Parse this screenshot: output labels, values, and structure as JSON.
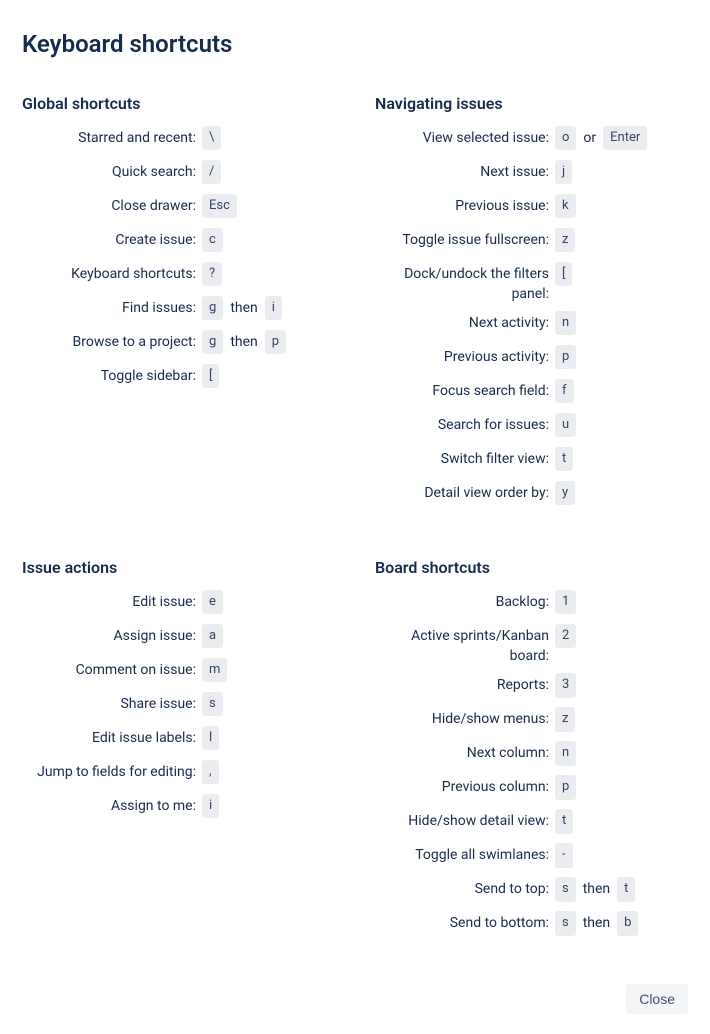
{
  "title": "Keyboard shortcuts",
  "close_label": "Close",
  "joiners": {
    "then": "then",
    "or": "or"
  },
  "sections": [
    {
      "id": "global",
      "heading": "Global shortcuts",
      "rows": [
        {
          "label": "Starred and recent:",
          "keys": [
            {
              "k": "\\"
            }
          ]
        },
        {
          "label": "Quick search:",
          "keys": [
            {
              "k": "/"
            }
          ]
        },
        {
          "label": "Close drawer:",
          "keys": [
            {
              "k": "Esc"
            }
          ]
        },
        {
          "label": "Create issue:",
          "keys": [
            {
              "k": "c"
            }
          ]
        },
        {
          "label": "Keyboard shortcuts:",
          "keys": [
            {
              "k": "?"
            }
          ]
        },
        {
          "label": "Find issues:",
          "keys": [
            {
              "k": "g"
            },
            {
              "j": "then"
            },
            {
              "k": "i"
            }
          ]
        },
        {
          "label": "Browse to a project:",
          "keys": [
            {
              "k": "g"
            },
            {
              "j": "then"
            },
            {
              "k": "p"
            }
          ]
        },
        {
          "label": "Toggle sidebar:",
          "keys": [
            {
              "k": "["
            }
          ]
        }
      ]
    },
    {
      "id": "navigating",
      "heading": "Navigating issues",
      "rows": [
        {
          "label": "View selected issue:",
          "keys": [
            {
              "k": "o"
            },
            {
              "j": "or"
            },
            {
              "k": "Enter"
            }
          ]
        },
        {
          "label": "Next issue:",
          "keys": [
            {
              "k": "j"
            }
          ]
        },
        {
          "label": "Previous issue:",
          "keys": [
            {
              "k": "k"
            }
          ]
        },
        {
          "label": "Toggle issue fullscreen:",
          "keys": [
            {
              "k": "z"
            }
          ]
        },
        {
          "label": "Dock/undock the filters panel:",
          "keys": [
            {
              "k": "["
            }
          ]
        },
        {
          "label": "Next activity:",
          "keys": [
            {
              "k": "n"
            }
          ]
        },
        {
          "label": "Previous activity:",
          "keys": [
            {
              "k": "p"
            }
          ]
        },
        {
          "label": "Focus search field:",
          "keys": [
            {
              "k": "f"
            }
          ]
        },
        {
          "label": "Search for issues:",
          "keys": [
            {
              "k": "u"
            }
          ]
        },
        {
          "label": "Switch filter view:",
          "keys": [
            {
              "k": "t"
            }
          ]
        },
        {
          "label": "Detail view order by:",
          "keys": [
            {
              "k": "y"
            }
          ]
        }
      ]
    },
    {
      "id": "issue_actions",
      "heading": "Issue actions",
      "rows": [
        {
          "label": "Edit issue:",
          "keys": [
            {
              "k": "e"
            }
          ]
        },
        {
          "label": "Assign issue:",
          "keys": [
            {
              "k": "a"
            }
          ]
        },
        {
          "label": "Comment on issue:",
          "keys": [
            {
              "k": "m"
            }
          ]
        },
        {
          "label": "Share issue:",
          "keys": [
            {
              "k": "s"
            }
          ]
        },
        {
          "label": "Edit issue labels:",
          "keys": [
            {
              "k": "l"
            }
          ]
        },
        {
          "label": "Jump to fields for editing:",
          "keys": [
            {
              "k": ","
            }
          ]
        },
        {
          "label": "Assign to me:",
          "keys": [
            {
              "k": "i"
            }
          ]
        }
      ]
    },
    {
      "id": "board",
      "heading": "Board shortcuts",
      "rows": [
        {
          "label": "Backlog:",
          "keys": [
            {
              "k": "1"
            }
          ]
        },
        {
          "label": "Active sprints/Kanban board:",
          "keys": [
            {
              "k": "2"
            }
          ]
        },
        {
          "label": "Reports:",
          "keys": [
            {
              "k": "3"
            }
          ]
        },
        {
          "label": "Hide/show menus:",
          "keys": [
            {
              "k": "z"
            }
          ]
        },
        {
          "label": "Next column:",
          "keys": [
            {
              "k": "n"
            }
          ]
        },
        {
          "label": "Previous column:",
          "keys": [
            {
              "k": "p"
            }
          ]
        },
        {
          "label": "Hide/show detail view:",
          "keys": [
            {
              "k": "t"
            }
          ]
        },
        {
          "label": "Toggle all swimlanes:",
          "keys": [
            {
              "k": "-"
            }
          ]
        },
        {
          "label": "Send to top:",
          "keys": [
            {
              "k": "s"
            },
            {
              "j": "then"
            },
            {
              "k": "t"
            }
          ]
        },
        {
          "label": "Send to bottom:",
          "keys": [
            {
              "k": "s"
            },
            {
              "j": "then"
            },
            {
              "k": "b"
            }
          ]
        }
      ]
    }
  ]
}
